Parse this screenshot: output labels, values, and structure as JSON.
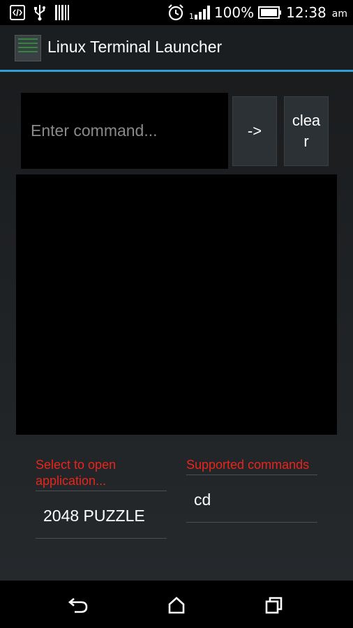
{
  "status_bar": {
    "battery": "100%",
    "time": "12:38",
    "ampm": "am"
  },
  "action_bar": {
    "title": "Linux Terminal Launcher"
  },
  "command": {
    "placeholder": "Enter command...",
    "value": "",
    "run_label": "->",
    "clear_label": "clear"
  },
  "output": {
    "text": ""
  },
  "app_spinner": {
    "label": "Select to open application...",
    "selected": "2048 PUZZLE"
  },
  "command_spinner": {
    "label": "Supported commands",
    "selected": "cd"
  },
  "colors": {
    "accent": "#2f9fd7",
    "label_red": "#e8251d"
  }
}
